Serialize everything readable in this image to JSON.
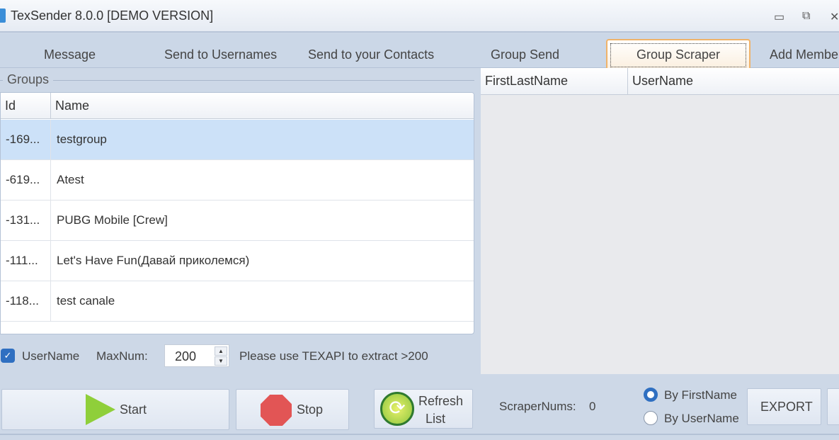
{
  "window": {
    "title": "TexSender 8.0.0 [DEMO VERSION]",
    "minimize": "▭",
    "maximize": "⧉",
    "close": "✕"
  },
  "tabs": [
    {
      "label": "Message"
    },
    {
      "label": "Send to Usernames"
    },
    {
      "label": "Send to your Contacts"
    },
    {
      "label": "Group Send"
    },
    {
      "label": "Group Scraper",
      "active": true
    },
    {
      "label": "Add Members"
    }
  ],
  "groups": {
    "label": "Groups",
    "columns": [
      "Id",
      "Name"
    ],
    "rows": [
      {
        "id": "-169...",
        "name": "testgroup",
        "selected": true
      },
      {
        "id": "-619...",
        "name": "Atest"
      },
      {
        "id": "-131...",
        "name": "PUBG Mobile [Crew]"
      },
      {
        "id": "-111...",
        "name": "Let's Have Fun(Давай приколемся)"
      },
      {
        "id": "-118...",
        "name": "test canale"
      }
    ]
  },
  "results": {
    "columns": [
      "FirstLastName",
      "UserName"
    ]
  },
  "options": {
    "username_label": "UserName",
    "username_checked": true,
    "maxnum_label": "MaxNum:",
    "maxnum_value": "200",
    "hint": "Please use TEXAPI to extract >200"
  },
  "buttons": {
    "start": "Start",
    "stop": "Stop",
    "refresh_line1": "Refresh",
    "refresh_line2": "List",
    "export": "EXPORT"
  },
  "status": {
    "scraper_label": "ScraperNums:",
    "scraper_value": "0"
  },
  "sort": {
    "by_firstname": "By FirstName",
    "by_username": "By UserName",
    "selected": "By FirstName"
  },
  "colors": {
    "accent": "#2f6fc1",
    "active_tab_border": "#f0b36a",
    "selected_row": "#cce1f8"
  }
}
